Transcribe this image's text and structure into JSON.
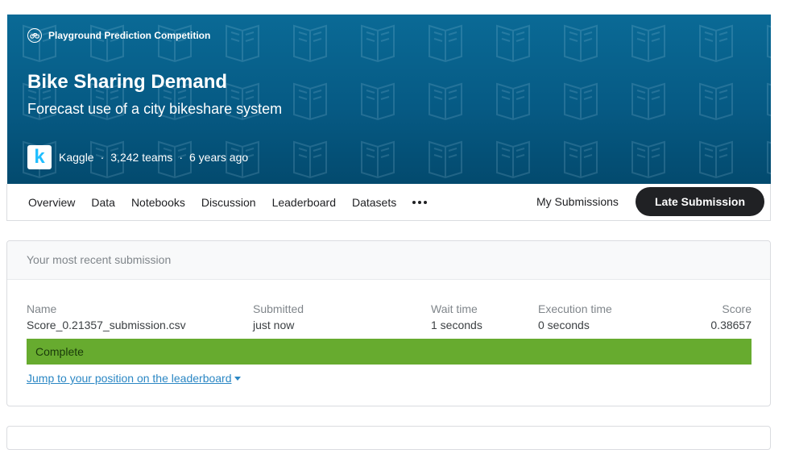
{
  "banner": {
    "competition_type": "Playground Prediction Competition",
    "type_icon": "bicycle-icon",
    "title": "Bike Sharing Demand",
    "subtitle": "Forecast use of a city bikeshare system",
    "host_logo_letter": "k",
    "host": "Kaggle",
    "separator": "·",
    "teams": "3,242 teams",
    "age": "6 years ago",
    "background_color": "#065a84",
    "pattern_icon": "book-icon"
  },
  "nav": {
    "tabs": [
      "Overview",
      "Data",
      "Notebooks",
      "Discussion",
      "Leaderboard",
      "Datasets"
    ],
    "more_icon": "more-horizontal-icon",
    "my_submissions": "My Submissions",
    "late_submission": "Late Submission"
  },
  "submission": {
    "header": "Your most recent submission",
    "columns": {
      "name": {
        "label": "Name",
        "value": "Score_0.21357_submission.csv"
      },
      "submitted": {
        "label": "Submitted",
        "value": "just now"
      },
      "wait_time": {
        "label": "Wait time",
        "value": "1 seconds"
      },
      "execution_time": {
        "label": "Execution time",
        "value": "0 seconds"
      },
      "score": {
        "label": "Score",
        "value": "0.38657"
      }
    },
    "status": "Complete",
    "status_color": "#67ab2f",
    "jump_link": "Jump to your position on the leaderboard",
    "link_color": "#2b87c4"
  }
}
